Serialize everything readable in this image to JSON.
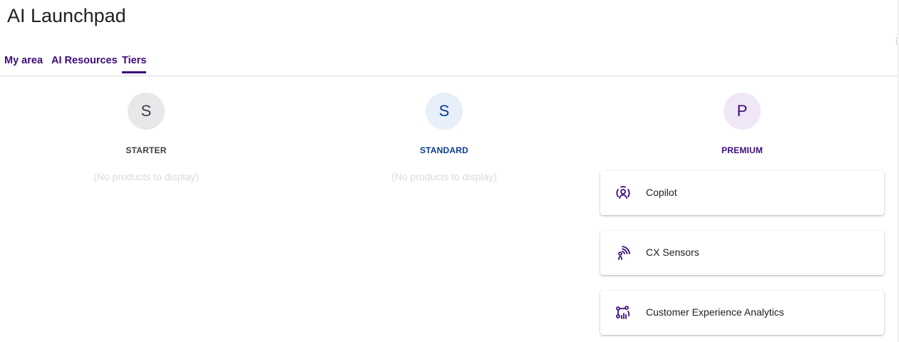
{
  "page_title": "AI Launchpad",
  "tabs": [
    {
      "label": "My area",
      "active": false
    },
    {
      "label": "AI Resources",
      "active": false
    },
    {
      "label": "Tiers",
      "active": true
    }
  ],
  "colors": {
    "accent": "#3d0b7a",
    "starter_text": "#3c4043",
    "starter_avatar_bg": "#e8e8ea",
    "standard_text": "#0b3d91",
    "standard_avatar_bg": "#e6effa",
    "premium_text": "#3d0b7a",
    "premium_avatar_bg": "#efe7f7"
  },
  "tiers": [
    {
      "initial": "S",
      "name": "STARTER",
      "empty_message": "(No products to display)"
    },
    {
      "initial": "S",
      "name": "STANDARD",
      "empty_message": "(No products to display)"
    },
    {
      "initial": "P",
      "name": "PREMIUM",
      "products": [
        {
          "name": "Copilot",
          "icon": "copilot-icon"
        },
        {
          "name": "CX Sensors",
          "icon": "sensor-icon"
        },
        {
          "name": "Customer Experience Analytics",
          "icon": "analytics-icon"
        }
      ]
    }
  ]
}
